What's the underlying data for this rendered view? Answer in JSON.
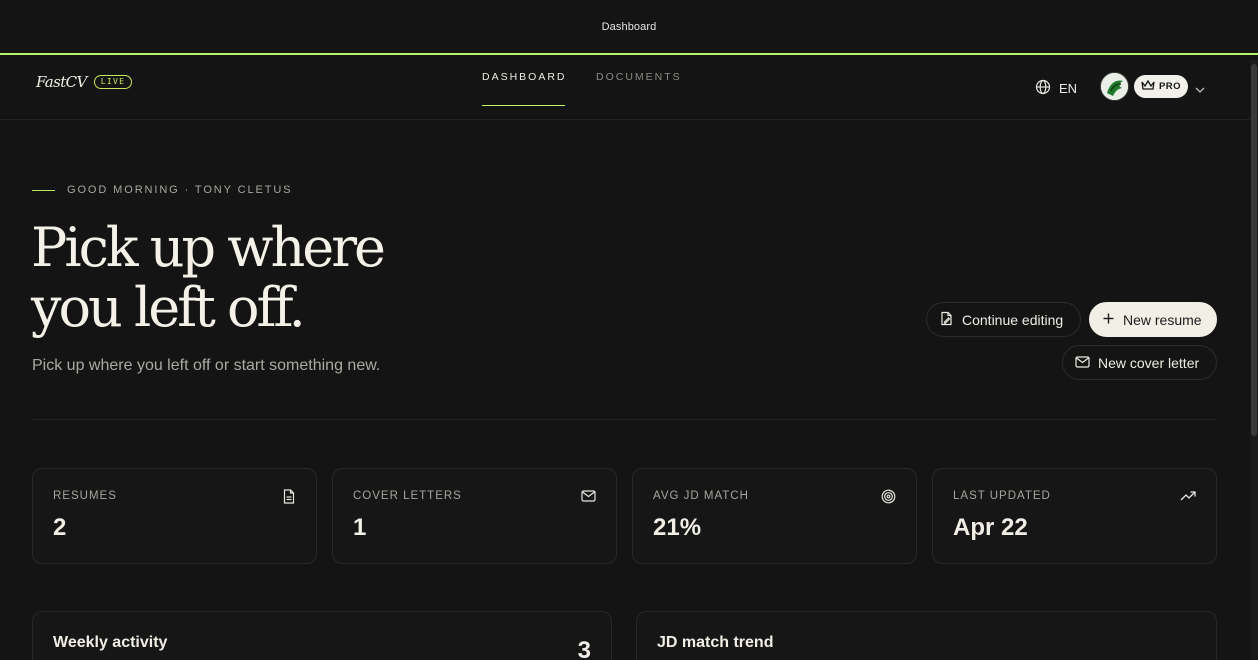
{
  "window": {
    "title": "Dashboard"
  },
  "brand": {
    "logo_text": "FastCV",
    "live_badge": "LIVE"
  },
  "nav": {
    "tabs": [
      {
        "label": "DASHBOARD",
        "active": true
      },
      {
        "label": "DOCUMENTS",
        "active": false
      }
    ],
    "language": "EN",
    "plan_badge": "PRO",
    "icons": {
      "language": "globe-icon",
      "plan": "crown-icon",
      "menu": "chevron-down-icon"
    }
  },
  "hero": {
    "greeting": "GOOD MORNING · TONY CLETUS",
    "title_line1": "Pick up where",
    "title_line2": "you left off.",
    "subtitle": "Pick up where you left off or start something new."
  },
  "actions": {
    "continue_editing": "Continue editing",
    "new_resume": "New resume",
    "new_cover_letter": "New cover letter"
  },
  "stats": [
    {
      "label": "RESUMES",
      "value": "2",
      "icon": "document-icon"
    },
    {
      "label": "COVER LETTERS",
      "value": "1",
      "icon": "mail-icon"
    },
    {
      "label": "AVG JD MATCH",
      "value": "21%",
      "icon": "target-icon"
    },
    {
      "label": "LAST UPDATED",
      "value": "Apr 22",
      "icon": "trending-up-icon"
    }
  ],
  "panels": {
    "weekly_activity": {
      "title": "Weekly activity",
      "count": "3"
    },
    "jd_match_trend": {
      "title": "JD match trend"
    }
  },
  "colors": {
    "accent": "#b6f36d",
    "background": "#141414",
    "text": "#e8e6e0"
  }
}
